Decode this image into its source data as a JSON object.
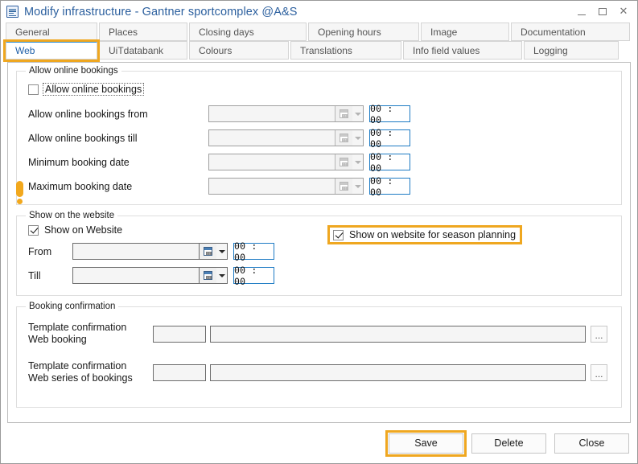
{
  "window": {
    "title": "Modify infrastructure - Gantner sportcomplex @A&S",
    "icon": "document-list-icon",
    "controls": {
      "minimize": "–",
      "maximize": "□",
      "close": "✕"
    }
  },
  "tabs": {
    "row1": [
      {
        "label": "General",
        "selected": false
      },
      {
        "label": "Places",
        "selected": false
      },
      {
        "label": "Closing days",
        "selected": false
      },
      {
        "label": "Opening hours",
        "selected": false
      },
      {
        "label": "Image",
        "selected": false
      },
      {
        "label": "Documentation",
        "selected": false
      }
    ],
    "row2": [
      {
        "label": "Web",
        "selected": true,
        "highlighted": true
      },
      {
        "label": "UiTdatabank",
        "selected": false
      },
      {
        "label": "Colours",
        "selected": false
      },
      {
        "label": "Translations",
        "selected": false
      },
      {
        "label": "Info field values",
        "selected": false
      },
      {
        "label": "Logging",
        "selected": false
      }
    ]
  },
  "groups": {
    "allow_online_bookings": {
      "title": "Allow online bookings",
      "checkbox": {
        "label": "Allow online bookings",
        "checked": false
      },
      "rows": [
        {
          "label": "Allow online bookings from",
          "date": "",
          "time": "00 : 00"
        },
        {
          "label": "Allow online bookings till",
          "date": "",
          "time": "00 : 00"
        },
        {
          "label": "Minimum booking date",
          "date": "",
          "time": "00 : 00"
        },
        {
          "label": "Maximum booking date",
          "date": "",
          "time": "00 : 00"
        }
      ]
    },
    "show_on_website": {
      "title": "Show on the website",
      "checkbox": {
        "label": "Show on Website",
        "checked": true
      },
      "season_checkbox": {
        "label": "Show on website for season planning",
        "checked": true,
        "highlighted": true
      },
      "rows": [
        {
          "label": "From",
          "date": "",
          "time": "00 : 00"
        },
        {
          "label": "Till",
          "date": "",
          "time": "00 : 00"
        }
      ]
    },
    "booking_confirmation": {
      "title": "Booking confirmation",
      "rows": [
        {
          "label_line1": "Template confirmation",
          "label_line2": "Web booking",
          "code": "",
          "value": "",
          "browse": "..."
        },
        {
          "label_line1": "Template confirmation",
          "label_line2": "Web series of bookings",
          "code": "",
          "value": "",
          "browse": "..."
        }
      ]
    }
  },
  "footer": {
    "save": "Save",
    "delete": "Delete",
    "close": "Close"
  },
  "colors": {
    "annotation": "#efa720",
    "tab_selected_text": "#1f5fa8",
    "title_text": "#2b5f9e",
    "time_border": "#1e7bc4"
  }
}
